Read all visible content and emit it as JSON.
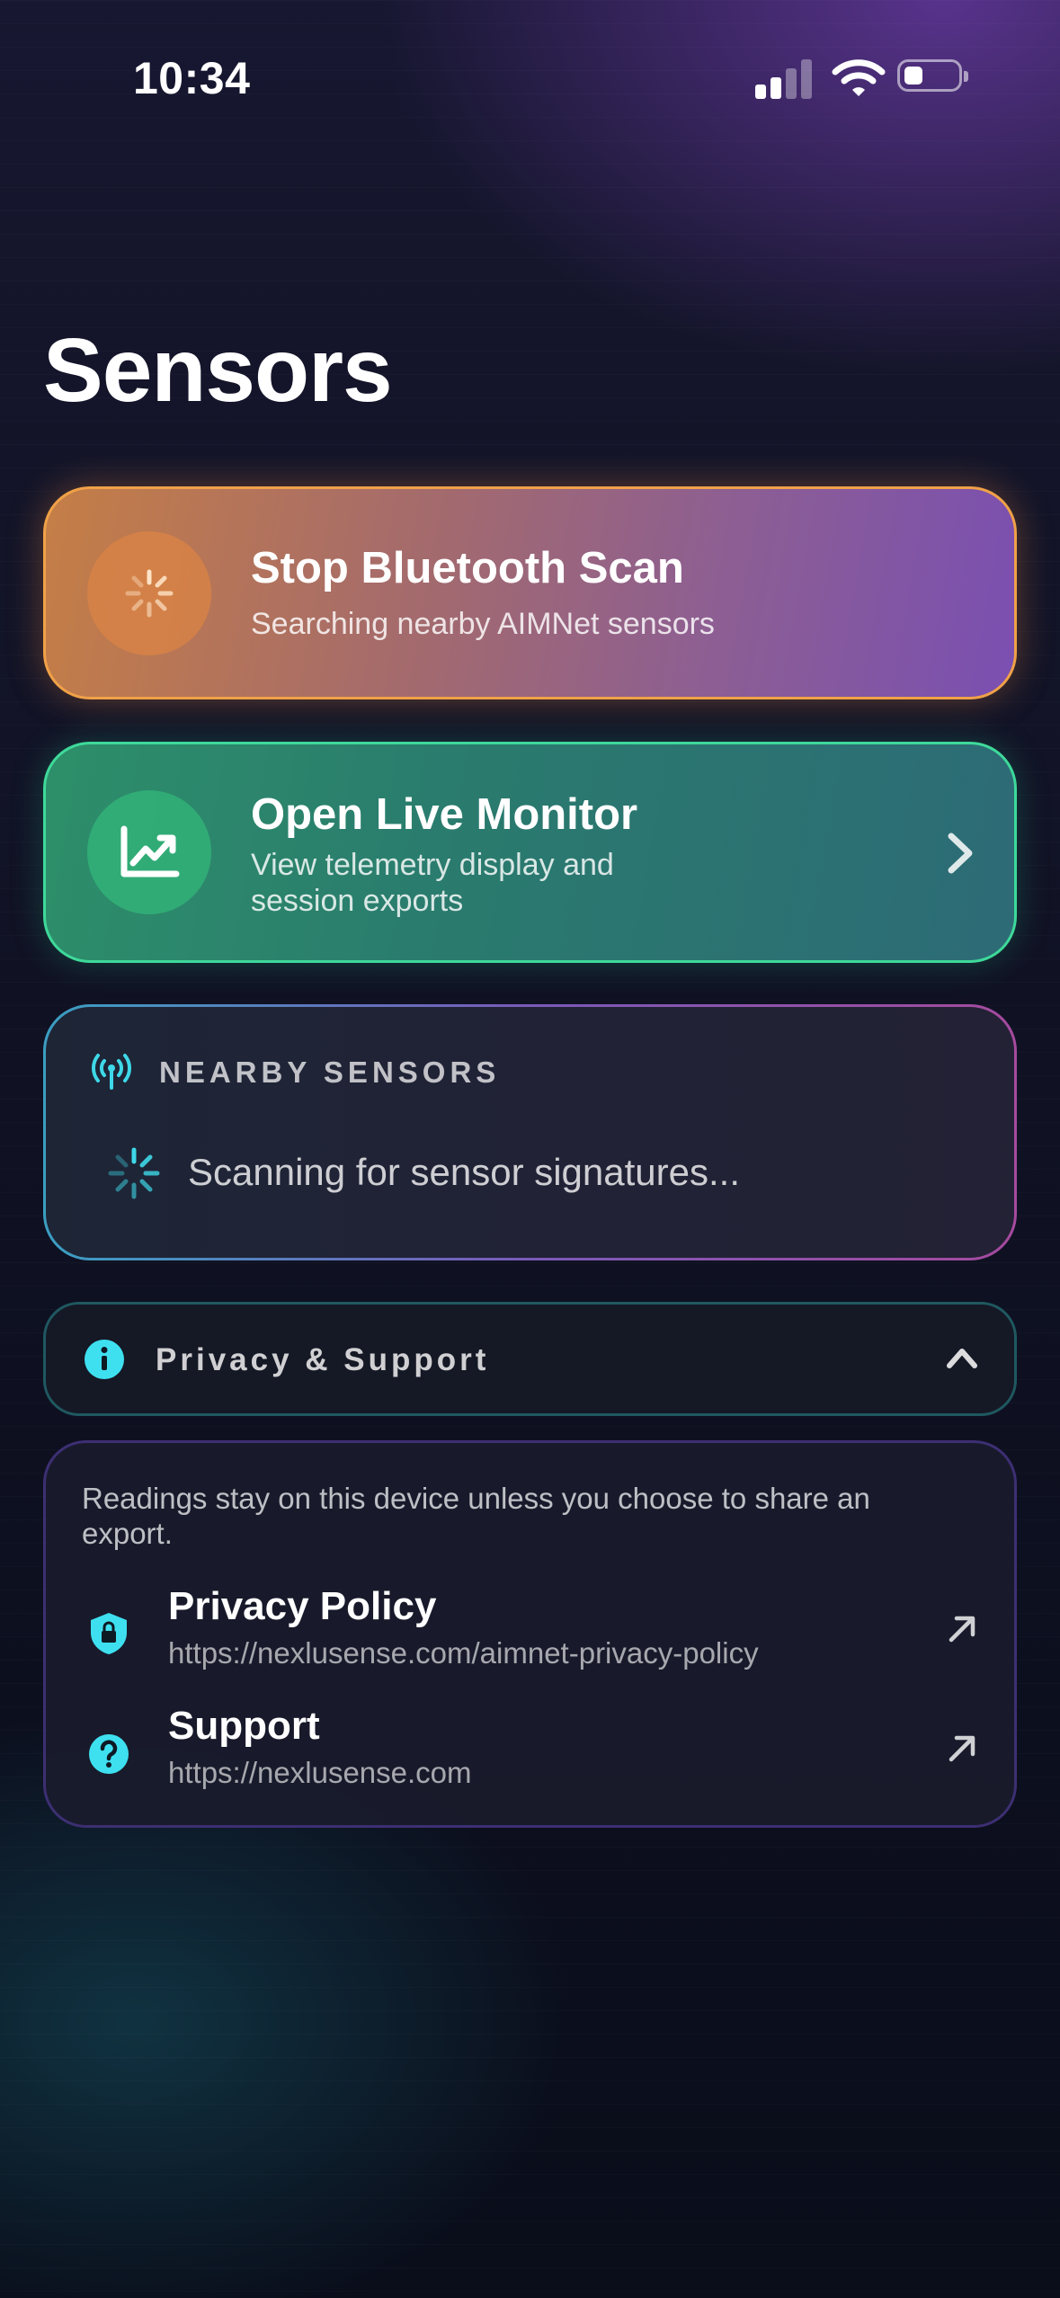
{
  "status_bar": {
    "time": "10:34"
  },
  "page": {
    "title": "Sensors"
  },
  "scan_card": {
    "title": "Stop Bluetooth Scan",
    "subtitle": "Searching nearby AIMNet sensors",
    "icon": "spinner-icon",
    "accent": "#f0a148"
  },
  "monitor_card": {
    "title": "Open Live Monitor",
    "subtitle": "View telemetry display and session exports",
    "icon": "chart-trend-icon",
    "accent": "#3ed99a"
  },
  "nearby": {
    "label": "NEARBY SENSORS",
    "status": "Scanning for sensor signatures...",
    "icon": "antenna-icon"
  },
  "privacy": {
    "header": "Privacy & Support",
    "expanded": true,
    "note": "Readings stay on this device unless you choose to share an export.",
    "links": [
      {
        "title": "Privacy Policy",
        "url": "https://nexlusense.com/aimnet-privacy-policy",
        "icon": "shield-lock-icon"
      },
      {
        "title": "Support",
        "url": "https://nexlusense.com",
        "icon": "help-circle-icon"
      }
    ]
  }
}
